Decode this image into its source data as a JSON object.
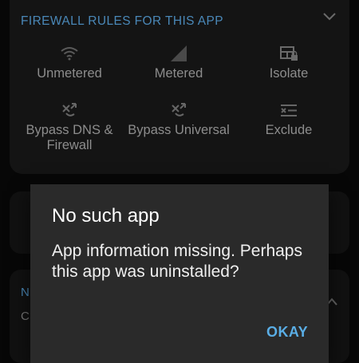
{
  "firewall_card": {
    "title": "FIREWALL RULES FOR THIS APP",
    "rules": [
      {
        "label": "Unmetered",
        "icon": "wifi-icon"
      },
      {
        "label": "Metered",
        "icon": "cellular-signal-icon"
      },
      {
        "label": "Isolate",
        "icon": "lock-grid-icon"
      },
      {
        "label": "Bypass DNS & Firewall",
        "icon": "bypass-icon"
      },
      {
        "label": "Bypass Universal",
        "icon": "bypass-icon"
      },
      {
        "label": "Exclude",
        "icon": "exclude-icon"
      }
    ]
  },
  "background_partial": {
    "n_letter": "N",
    "c_letter": "C"
  },
  "dialog": {
    "title": "No such app",
    "message": "App information missing. Perhaps this app was uninstalled?",
    "ok_label": "OKAY"
  },
  "colors": {
    "accent": "#4a88b8",
    "dialog_button": "#5aaee6",
    "dialog_bg": "#2a2a2a"
  }
}
